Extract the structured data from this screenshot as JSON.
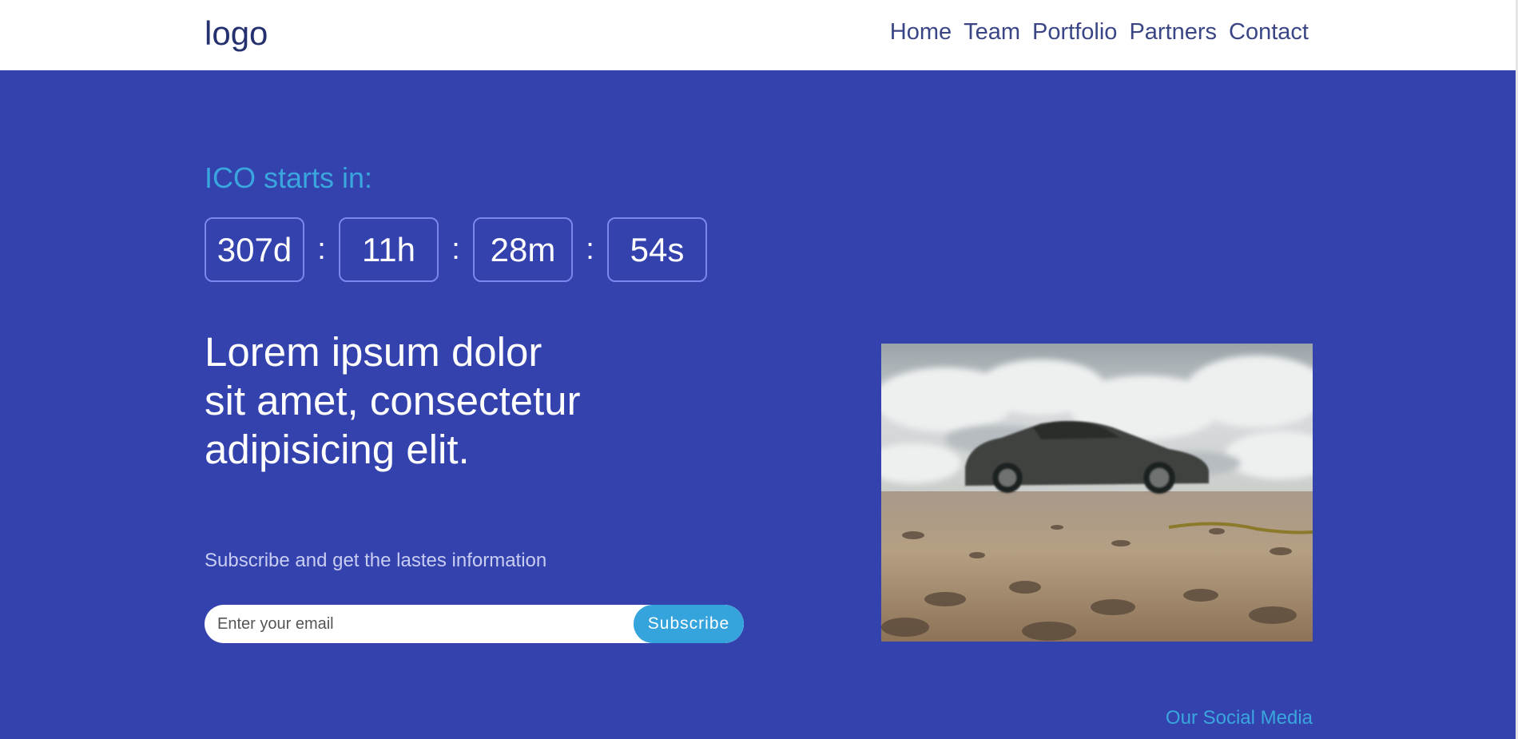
{
  "header": {
    "logo": "logo",
    "nav": [
      "Home",
      "Team",
      "Portfolio",
      "Partners",
      "Contact"
    ]
  },
  "hero": {
    "ico_label": "ICO starts in:",
    "countdown": {
      "days": "307d",
      "hours": "11h",
      "minutes": "28m",
      "seconds": "54s",
      "separator": ":"
    },
    "headline_lines": [
      "Lorem ipsum dolor",
      "sit amet, consectetur",
      "adipisicing elit."
    ],
    "subscribe_text": "Subscribe and get the lastes information",
    "email_placeholder": "Enter your email",
    "subscribe_button": "Subscribe",
    "image_alt": "car-on-beach-photo"
  },
  "footer": {
    "social_label": "Our Social Media"
  },
  "colors": {
    "background": "#3442ae",
    "accent": "#3aa6de",
    "header_text": "#25306f"
  }
}
